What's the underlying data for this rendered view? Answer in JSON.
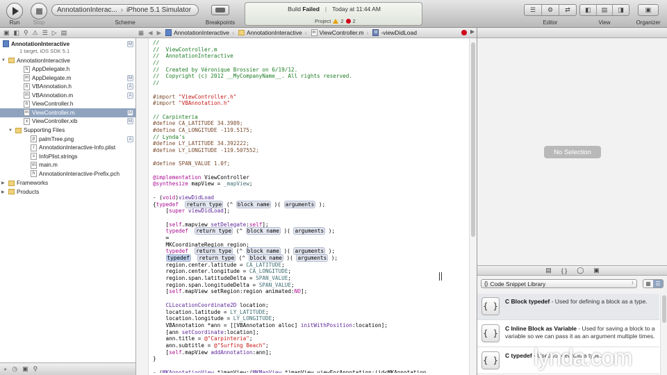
{
  "toolbar": {
    "run_label": "Run",
    "stop_label": "Stop",
    "scheme_target": "AnnotationInterac...",
    "scheme_separator": "›",
    "scheme_destination": "iPhone 5.1 Simulator",
    "scheme_label": "Scheme",
    "breakpoints_label": "Breakpoints",
    "editor_label": "Editor",
    "view_label": "View",
    "organizer_label": "Organizer"
  },
  "status": {
    "build_prefix": "Build",
    "build_result": "Failed",
    "separator": "|",
    "time": "Today at 11:44 AM",
    "project_label": "Project",
    "warning_count": "2",
    "error_count": "2",
    "warning_color": "#e8a000",
    "error_color": "#d0021b"
  },
  "navigator": {
    "items": [
      {
        "label": "AnnotationInteractive",
        "bold": true,
        "badge": "M"
      },
      {
        "label": "1 target, iOS SDK 5.1"
      },
      {
        "label": "AnnotationInteractive",
        "badge": ""
      },
      {
        "label": "AppDelegate.h",
        "badge": ""
      },
      {
        "label": "AppDelegate.m",
        "badge": "M"
      },
      {
        "label": "VBAnnotation.h",
        "badge": "A"
      },
      {
        "label": "VBAnnotation.m",
        "badge": "A"
      },
      {
        "label": "ViewController.h",
        "badge": ""
      },
      {
        "label": "ViewController.m",
        "badge": "M"
      },
      {
        "label": "ViewController.xib",
        "badge": "M"
      },
      {
        "label": "Supporting Files",
        "badge": ""
      },
      {
        "label": "palmTree.png",
        "badge": "A"
      },
      {
        "label": "AnnotationInteractive-Info.plist",
        "badge": ""
      },
      {
        "label": "InfoPlist.strings",
        "badge": ""
      },
      {
        "label": "main.m",
        "badge": ""
      },
      {
        "label": "AnnotationInteractive-Prefix.pch",
        "badge": ""
      },
      {
        "label": "Frameworks",
        "badge": ""
      },
      {
        "label": "Products",
        "badge": ""
      }
    ]
  },
  "jumpbar": {
    "crumbs": [
      "AnnotationInteractive",
      "AnnotationInteractive",
      "ViewController.m",
      "-viewDidLoad"
    ]
  },
  "code": {
    "lines": [
      "//",
      "//  ViewController.m",
      "//  AnnotationInteractive",
      "//",
      "//  Created by Véronique Brossier on 6/19/12.",
      "//  Copyright (c) 2012 __MyCompanyName__. All rights reserved.",
      "//",
      "",
      "#import \"ViewController.h\"",
      "#import \"VBAnnotation.h\"",
      "",
      "// Carpinteria",
      "#define CA_LATITUDE 34.3989;",
      "#define CA_LONGITUDE -119.5175;",
      "// Lynda's",
      "#define LY_LATITUDE 34.392222;",
      "#define LY_LONGITUDE -119.507552;",
      "",
      "#define SPAN_VALUE 1.0f;",
      "",
      "@implementation ViewController",
      "@synthesize mapView = _mapView;",
      "",
      "- (void)viewDidLoad",
      "{typedef  return type (^ block name )( arguments );",
      "    [super viewDidLoad];",
      "",
      "    [self.mapview setDelegate:self];",
      "    typedef  return type (^ block name )( arguments );",
      "    ∞",
      "    MKCoordinateRegion region;",
      "    typedef  return type (^ block name )( arguments );",
      "    typedef  return type (^ block name )( arguments );",
      "    region.center.latitude = CA_LATITUDE;",
      "    region.center.longitude = CA_LONGITUDE;",
      "    region.span.latitudeDelta = SPAN_VALUE;",
      "    region.span.longitudeDelta = SPAN_VALUE;",
      "    [self.mapView setRegion:region animated:NO];",
      "",
      "    CLLocationCoordinate2D location;",
      "    location.latitude = LY_LATITUDE;",
      "    location.longitude = LY_LONGITUDE;",
      "    VBAnnotation *ann = [[VBAnnotation alloc] initWithPosition:location];",
      "    [ann setCoordinate:location];",
      "    ann.title = @\"Carpinteria\";",
      "    ann.subtitle = @\"Surfing Beach\";",
      "    [self.mapView addAnnotation:ann];",
      "}",
      "",
      "- (MKAnnotationView *)mapView:(MKMapView *)mapView viewForAnnotation:(id<MKAnnotation"
    ]
  },
  "inspector": {
    "no_selection": "No Selection"
  },
  "library": {
    "selected": "Code Snippet Library",
    "snippets": [
      {
        "title": "C Block typedef",
        "desc": " - Used for defining a block as a type."
      },
      {
        "title": "C Inline Block as Variable",
        "desc": " - Used for saving a block to a variable so we can pass it as an argument multiple times."
      },
      {
        "title": "C typedef",
        "desc": " - Used for defining a type."
      }
    ]
  },
  "watermark": "lynda.com"
}
